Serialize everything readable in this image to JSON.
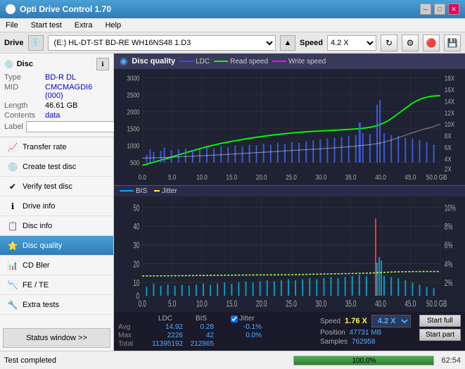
{
  "titlebar": {
    "title": "Opti Drive Control 1.70",
    "icon": "●",
    "controls": {
      "minimize": "─",
      "maximize": "□",
      "close": "✕"
    }
  },
  "menubar": {
    "items": [
      "File",
      "Start test",
      "Extra",
      "Help"
    ]
  },
  "drivebar": {
    "drive_label": "Drive",
    "drive_value": "(E:)  HL-DT-ST BD-RE  WH16NS48 1.D3",
    "speed_label": "Speed",
    "speed_value": "4.2 X"
  },
  "sidebar": {
    "disc_section": {
      "title": "Disc",
      "rows": [
        {
          "label": "Type",
          "value": "BD-R DL"
        },
        {
          "label": "MID",
          "value": "CMCMAGDI6 (000)"
        },
        {
          "label": "Length",
          "value": "46.61 GB"
        },
        {
          "label": "Contents",
          "value": "data"
        },
        {
          "label": "Label",
          "value": ""
        }
      ]
    },
    "nav_items": [
      {
        "label": "Transfer rate",
        "icon": "📈",
        "active": false
      },
      {
        "label": "Create test disc",
        "icon": "💿",
        "active": false
      },
      {
        "label": "Verify test disc",
        "icon": "✔",
        "active": false
      },
      {
        "label": "Drive info",
        "icon": "ℹ",
        "active": false
      },
      {
        "label": "Disc info",
        "icon": "📋",
        "active": false
      },
      {
        "label": "Disc quality",
        "icon": "⭐",
        "active": true
      },
      {
        "label": "CD Bler",
        "icon": "📊",
        "active": false
      },
      {
        "label": "FE / TE",
        "icon": "📉",
        "active": false
      },
      {
        "label": "Extra tests",
        "icon": "🔧",
        "active": false
      }
    ],
    "status_btn": "Status window >>"
  },
  "chart": {
    "title": "Disc quality",
    "legend": [
      {
        "label": "LDC",
        "color": "#4444ff"
      },
      {
        "label": "Read speed",
        "color": "#00ff00"
      },
      {
        "label": "Write speed",
        "color": "#ff00ff"
      }
    ],
    "legend2": [
      {
        "label": "BIS",
        "color": "#00aaff"
      },
      {
        "label": "Jitter",
        "color": "#ffff00"
      }
    ],
    "top_y_left": [
      "3000",
      "2500",
      "2000",
      "1500",
      "1000",
      "500",
      "0"
    ],
    "top_y_right": [
      "18X",
      "16X",
      "14X",
      "12X",
      "10X",
      "8X",
      "6X",
      "4X",
      "2X"
    ],
    "bottom_y_left": [
      "50",
      "40",
      "30",
      "20",
      "10",
      "0"
    ],
    "bottom_y_right": [
      "10%",
      "8%",
      "6%",
      "4%",
      "2%"
    ],
    "x_labels": [
      "0.0",
      "5.0",
      "10.0",
      "15.0",
      "20.0",
      "25.0",
      "30.0",
      "35.0",
      "40.0",
      "45.0",
      "50.0 GB"
    ]
  },
  "stats": {
    "columns": [
      {
        "header": "LDC",
        "avg": "14.92",
        "max": "2226",
        "total": "11395192"
      },
      {
        "header": "BIS",
        "avg": "0.28",
        "max": "42",
        "total": "212865"
      },
      {
        "header": "",
        "avg": "",
        "max": "",
        "total": ""
      },
      {
        "header": "Jitter",
        "avg": "-0.1%",
        "max": "0.0%",
        "total": ""
      },
      {
        "header": "Speed",
        "avg": "",
        "max": "",
        "total": ""
      },
      {
        "header": "Position",
        "avg": "",
        "max": "",
        "total": ""
      }
    ],
    "ldc_avg": "14.92",
    "ldc_max": "2226",
    "ldc_total": "11395192",
    "bis_avg": "0.28",
    "bis_max": "42",
    "bis_total": "212865",
    "jitter_avg": "-0.1%",
    "jitter_max": "0.0%",
    "jitter_checked": true,
    "speed_val": "1.76 X",
    "speed_dropdown": "4.2 X",
    "position_val": "47731 MB",
    "samples_val": "762958",
    "row_labels": [
      "Avg",
      "Max",
      "Total"
    ],
    "col_ldc": "LDC",
    "col_bis": "BIS",
    "col_jitter": "Jitter",
    "col_speed": "Speed",
    "col_position": "Position",
    "col_samples": "Samples"
  },
  "buttons": {
    "start_full": "Start full",
    "start_part": "Start part"
  },
  "bottombar": {
    "status": "Test completed",
    "progress": 100,
    "progress_text": "100.0%",
    "time": "62:54"
  }
}
